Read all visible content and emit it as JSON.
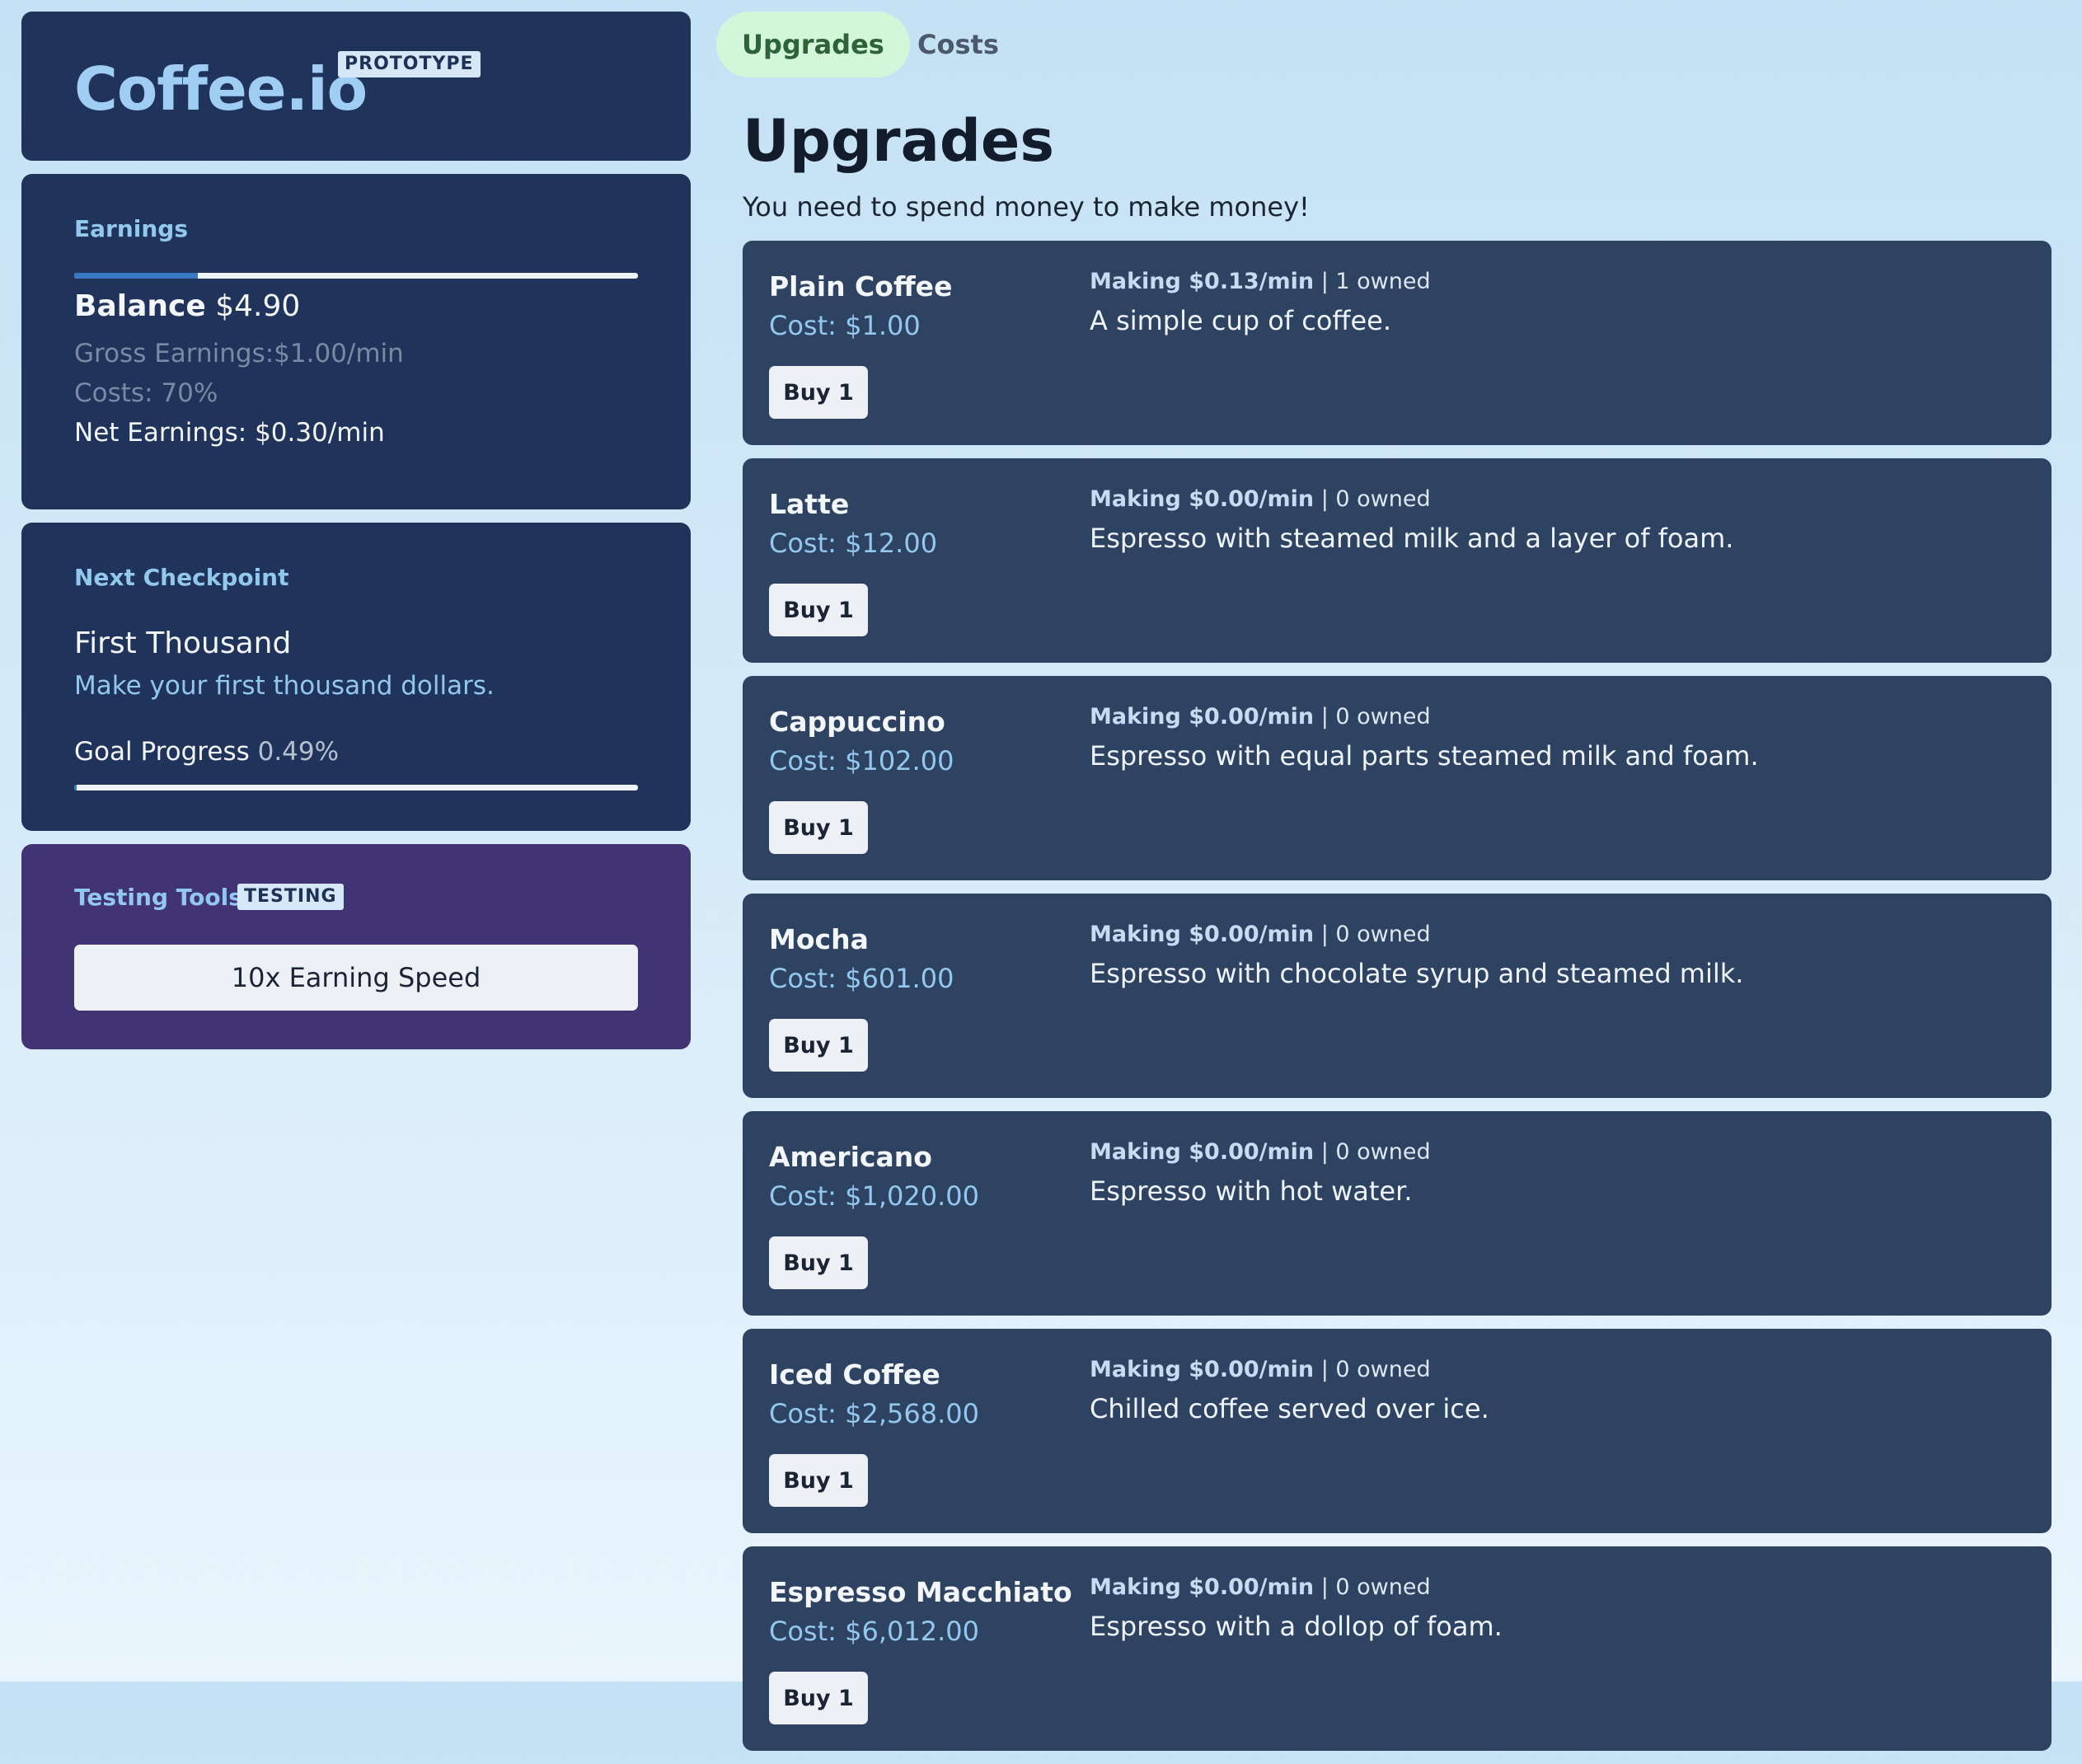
{
  "brand": {
    "title": "Coffee.io",
    "tag": "PROTOTYPE"
  },
  "earnings": {
    "label": "Earnings",
    "progress": 0.22,
    "balance_label": "Balance",
    "balance_value": "$4.90",
    "gross": "Gross Earnings:$1.00/min",
    "costs": "Costs: 70%",
    "net": "Net Earnings: $0.30/min"
  },
  "checkpoint": {
    "label": "Next Checkpoint",
    "title": "First Thousand",
    "desc": "Make your first thousand dollars.",
    "goal_label": "Goal Progress",
    "goal_pct": "0.49%",
    "progress": 0.0049
  },
  "testing": {
    "label": "Testing Tools",
    "tag": "TESTING",
    "button": "10x Earning Speed"
  },
  "tabs": [
    {
      "label": "Upgrades",
      "active": true
    },
    {
      "label": "Costs",
      "active": false
    }
  ],
  "page": {
    "title": "Upgrades",
    "subtitle": "You need to spend money to make money!"
  },
  "upgrades": [
    {
      "name": "Plain Coffee",
      "cost": "Cost: $1.00",
      "making": "Making $0.13/min",
      "owned": " | 1 owned",
      "desc": "A simple cup of coffee.",
      "buy": "Buy 1"
    },
    {
      "name": "Latte",
      "cost": "Cost: $12.00",
      "making": "Making $0.00/min",
      "owned": " | 0 owned",
      "desc": "Espresso with steamed milk and a layer of foam.",
      "buy": "Buy 1"
    },
    {
      "name": "Cappuccino",
      "cost": "Cost: $102.00",
      "making": "Making $0.00/min",
      "owned": " | 0 owned",
      "desc": "Espresso with equal parts steamed milk and foam.",
      "buy": "Buy 1"
    },
    {
      "name": "Mocha",
      "cost": "Cost: $601.00",
      "making": "Making $0.00/min",
      "owned": " | 0 owned",
      "desc": "Espresso with chocolate syrup and steamed milk.",
      "buy": "Buy 1"
    },
    {
      "name": "Americano",
      "cost": "Cost: $1,020.00",
      "making": "Making $0.00/min",
      "owned": " | 0 owned",
      "desc": "Espresso with hot water.",
      "buy": "Buy 1"
    },
    {
      "name": "Iced Coffee",
      "cost": "Cost: $2,568.00",
      "making": "Making $0.00/min",
      "owned": " | 0 owned",
      "desc": "Chilled coffee served over ice.",
      "buy": "Buy 1"
    },
    {
      "name": "Espresso Macchiato",
      "cost": "Cost: $6,012.00",
      "making": "Making $0.00/min",
      "owned": " | 0 owned",
      "desc": "Espresso with a dollop of foam.",
      "buy": "Buy 1"
    }
  ]
}
